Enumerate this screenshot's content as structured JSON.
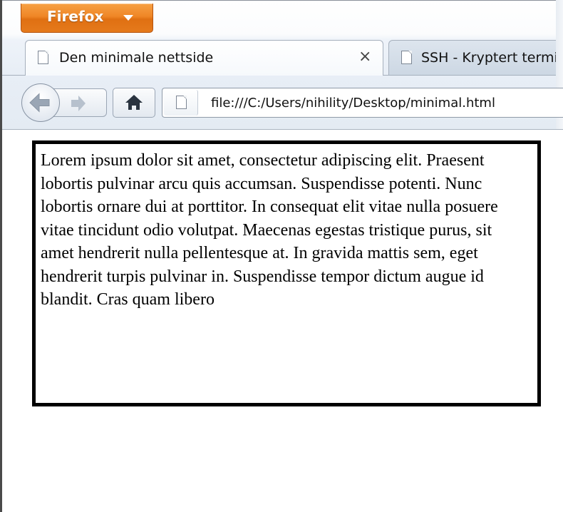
{
  "app_button": {
    "label": "Firefox"
  },
  "tabs": [
    {
      "title": "Den minimale nettside",
      "active": true,
      "close_label": "×"
    },
    {
      "title": "SSH - Kryptert terminal",
      "active": false
    }
  ],
  "navigation": {
    "url": "file:///C:/Users/nihility/Desktop/minimal.html"
  },
  "page": {
    "paragraph": "Lorem ipsum dolor sit amet, consectetur adipiscing elit. Praesent lobortis pulvinar arcu quis accumsan. Suspendisse potenti. Nunc lobortis ornare dui at porttitor. In consequat elit vitae nulla posuere vitae tincidunt odio volutpat. Maecenas egestas tristique purus, sit amet hendrerit nulla pellentesque at. In gravida mattis sem, eget hendrerit turpis pulvinar in. Suspendisse tempor dictum augue id blandit. Cras quam libero"
  },
  "colors": {
    "app_button": "#e57a1c",
    "content_border": "#000000",
    "chrome_background": "#e8eef6"
  },
  "icons": [
    "dropdown-arrow-icon",
    "page-icon",
    "close-icon",
    "back-arrow-icon",
    "forward-arrow-icon",
    "home-icon"
  ]
}
